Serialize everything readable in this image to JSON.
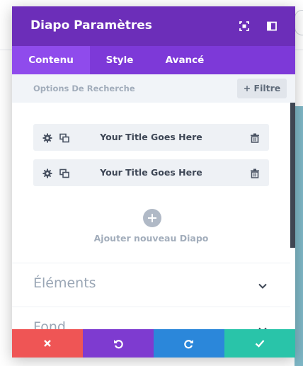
{
  "modal": {
    "title": "Diapo Paramètres",
    "header_icons": [
      "expand-icon",
      "sidebar-icon"
    ],
    "colors": {
      "header": "#6c2eb9",
      "tabs": "#7d39d8",
      "active_tab": "#8f4bec",
      "cancel": "#ef5555",
      "undo": "#7e3bd0",
      "redo": "#2b87da",
      "save": "#29c4a9"
    }
  },
  "tabs": [
    {
      "label": "Contenu",
      "active": true
    },
    {
      "label": "Style",
      "active": false
    },
    {
      "label": "Avancé",
      "active": false
    }
  ],
  "search": {
    "label": "Options De Recherche",
    "filter_label": "+ Filtre"
  },
  "items": [
    {
      "title": "Your Title Goes Here"
    },
    {
      "title": "Your Title Goes Here"
    }
  ],
  "add": {
    "label": "Ajouter nouveau Diapo"
  },
  "sections": [
    {
      "title": "Éléments"
    },
    {
      "title": "Fond"
    }
  ],
  "footer": {
    "buttons": [
      "close-icon",
      "undo-icon",
      "redo-icon",
      "check-icon"
    ]
  }
}
